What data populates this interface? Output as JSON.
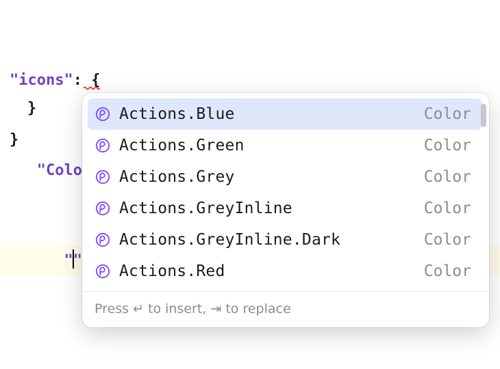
{
  "code": {
    "line1_key": "\"icons\"",
    "line1_rest": ": {",
    "line2_key": "\"ColorPalette\"",
    "line2_rest": ": {",
    "line3_quotes": "\"\"",
    "brace3": "}",
    "brace4": "}"
  },
  "completion": {
    "items": [
      {
        "label": "Actions.Blue",
        "type": "Color",
        "selected": true
      },
      {
        "label": "Actions.Green",
        "type": "Color"
      },
      {
        "label": "Actions.Grey",
        "type": "Color"
      },
      {
        "label": "Actions.GreyInline",
        "type": "Color"
      },
      {
        "label": "Actions.GreyInline.Dark",
        "type": "Color"
      },
      {
        "label": "Actions.Red",
        "type": "Color"
      }
    ],
    "footer": {
      "prefix": "Press ",
      "enter_glyph": "↵",
      "mid": " to insert, ",
      "tab_glyph": "⇥",
      "suffix": " to replace"
    }
  },
  "colors": {
    "icon_ring": "#7c4dff",
    "selection_bg": "#dfe7fb",
    "error": "#e53935"
  }
}
